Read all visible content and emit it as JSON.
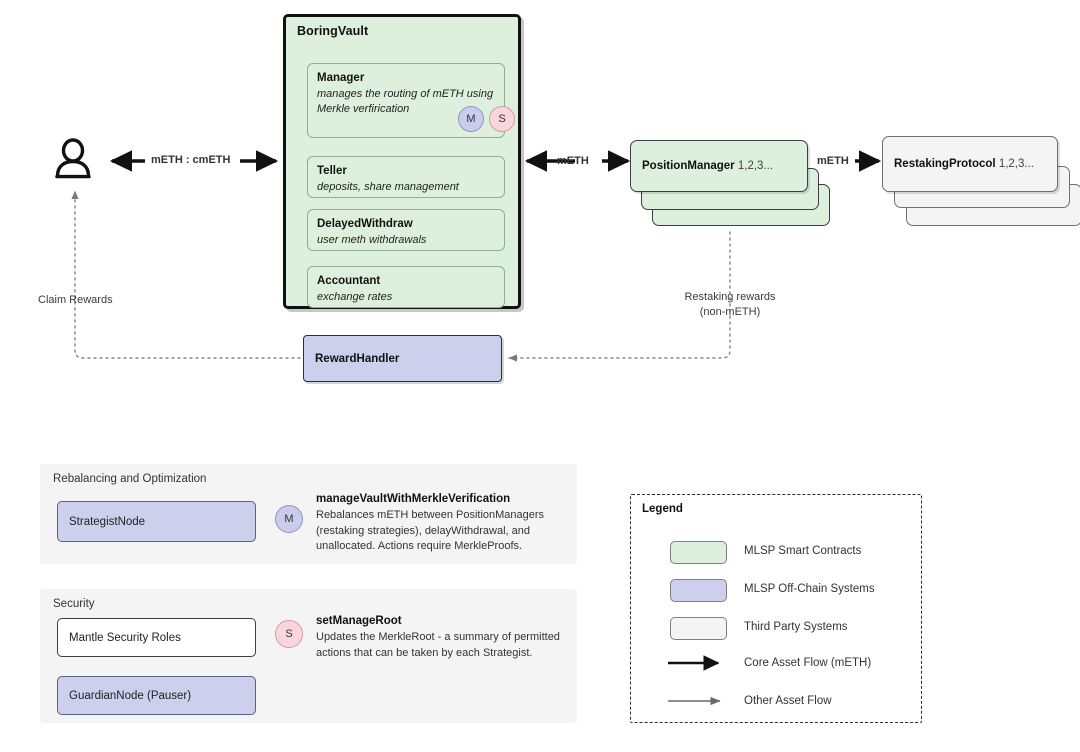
{
  "diagram": {
    "vault": {
      "title": "BoringVault",
      "components": [
        {
          "name": "Manager",
          "desc": "manages the routing of mETH using Merkle verfirication",
          "badges": [
            "M",
            "S"
          ]
        },
        {
          "name": "Teller",
          "desc": "deposits, share management",
          "badges": []
        },
        {
          "name": "DelayedWithdraw",
          "desc": "user meth withdrawals",
          "badges": []
        },
        {
          "name": "Accountant",
          "desc": "exchange rates",
          "badges": []
        }
      ]
    },
    "actors": {
      "user_icon": "user-icon"
    },
    "nodes": {
      "position_manager": {
        "name": "PositionManager",
        "suffix": "1,2,3..."
      },
      "restaking_protocol": {
        "name": "RestakingProtocol",
        "suffix": "1,2,3..."
      },
      "reward_handler": {
        "name": "RewardHandler"
      }
    },
    "flows": {
      "user_vault": "mETH : cmETH",
      "vault_position": "mETH",
      "position_restaking": "mETH",
      "claim_rewards": "Claim Rewards",
      "restaking_rewards_line1": "Restaking rewards",
      "restaking_rewards_line2": "(non-mETH)"
    }
  },
  "panels": [
    {
      "title": "Rebalancing and Optimization",
      "nodes": [
        {
          "label": "StrategistNode",
          "style": "purple"
        }
      ],
      "badge": "M",
      "action_title": "manageVaultWithMerkleVerification",
      "action_desc": "Rebalances mETH between PositionManagers (restaking strategies), delayWithdrawal, and unallocated. Actions require MerkleProofs."
    },
    {
      "title": "Security",
      "nodes": [
        {
          "label": "Mantle Security Roles",
          "style": "white"
        },
        {
          "label": "GuardianNode (Pauser)",
          "style": "purple"
        }
      ],
      "badge": "S",
      "action_title": "setManageRoot",
      "action_desc": "Updates the MerkleRoot - a summary of permitted actions that can be taken by each Strategist."
    }
  ],
  "legend": {
    "title": "Legend",
    "swatches": [
      {
        "label": "MLSP Smart Contracts",
        "color": "#ddf0de"
      },
      {
        "label": "MLSP Off-Chain Systems",
        "color": "#ccd0ec"
      },
      {
        "label": "Third Party Systems",
        "color": "#f4f4f4"
      }
    ],
    "arrows": [
      {
        "label": "Core Asset Flow (mETH)",
        "style": "thick-black"
      },
      {
        "label": "Other Asset Flow",
        "style": "thin-grey"
      }
    ]
  }
}
